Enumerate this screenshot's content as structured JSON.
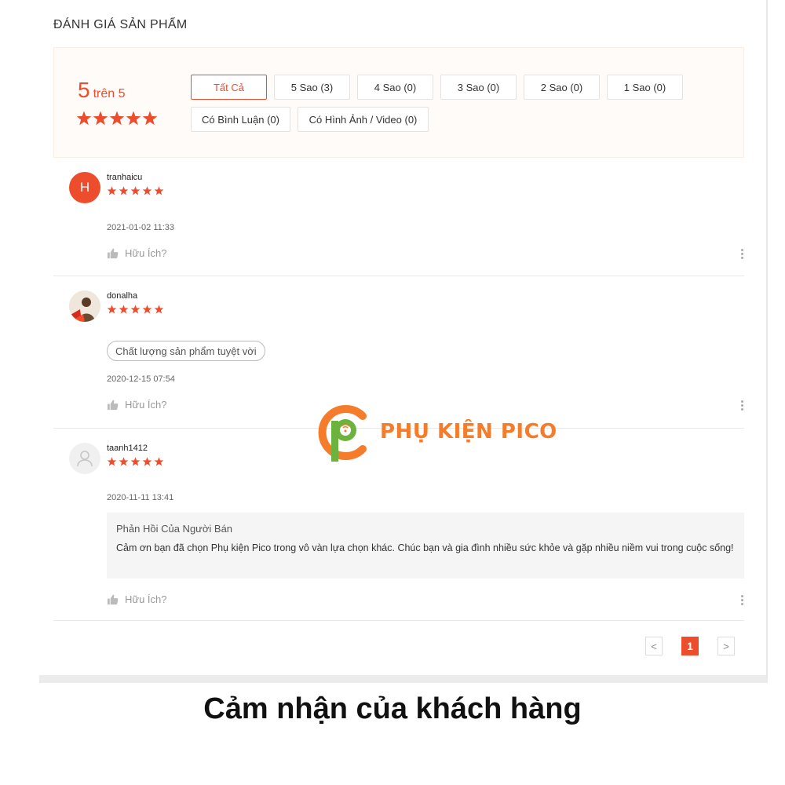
{
  "section_title": "ĐÁNH GIÁ SẢN PHẨM",
  "overview": {
    "score": "5",
    "score_suffix": "trên 5",
    "stars": 5,
    "filters_row1": [
      "Tất Cả",
      "5 Sao (3)",
      "4 Sao (0)",
      "3 Sao (0)",
      "2 Sao (0)",
      "1 Sao (0)"
    ],
    "filters_row2": [
      "Có Bình Luận (0)",
      "Có Hình Ảnh / Video (0)"
    ],
    "active_filter": "Tất Cả"
  },
  "reviews": [
    {
      "username": "tranhaicu",
      "avatar_letter": "H",
      "rating": 5,
      "date": "2021-01-02 11:33",
      "helpful_label": "Hữu Ích?"
    },
    {
      "username": "donalha",
      "rating": 5,
      "tag": "Chất lượng sản phẩm tuyệt vời",
      "date": "2020-12-15 07:54",
      "helpful_label": "Hữu Ích?"
    },
    {
      "username": "taanh1412",
      "rating": 5,
      "date": "2020-11-11 13:41",
      "seller_reply_title": "Phản Hồi Của Người Bán",
      "seller_reply_text": "Cảm ơn bạn đã chọn Phụ kiện Pico trong vô vàn lựa chọn khác. Chúc bạn và gia đình nhiều sức khỏe và gặp nhiều niềm vui trong cuộc sống!",
      "helpful_label": "Hữu Ích?"
    }
  ],
  "pagination": {
    "prev": "<",
    "current": "1",
    "next": ">"
  },
  "watermark": "PHỤ KIỆN PICO",
  "caption": "Cảm nhận của khách hàng",
  "colors": {
    "accent": "#ee4d2d",
    "watermark": "#f47c2a",
    "watermark_green": "#6cb33e"
  }
}
